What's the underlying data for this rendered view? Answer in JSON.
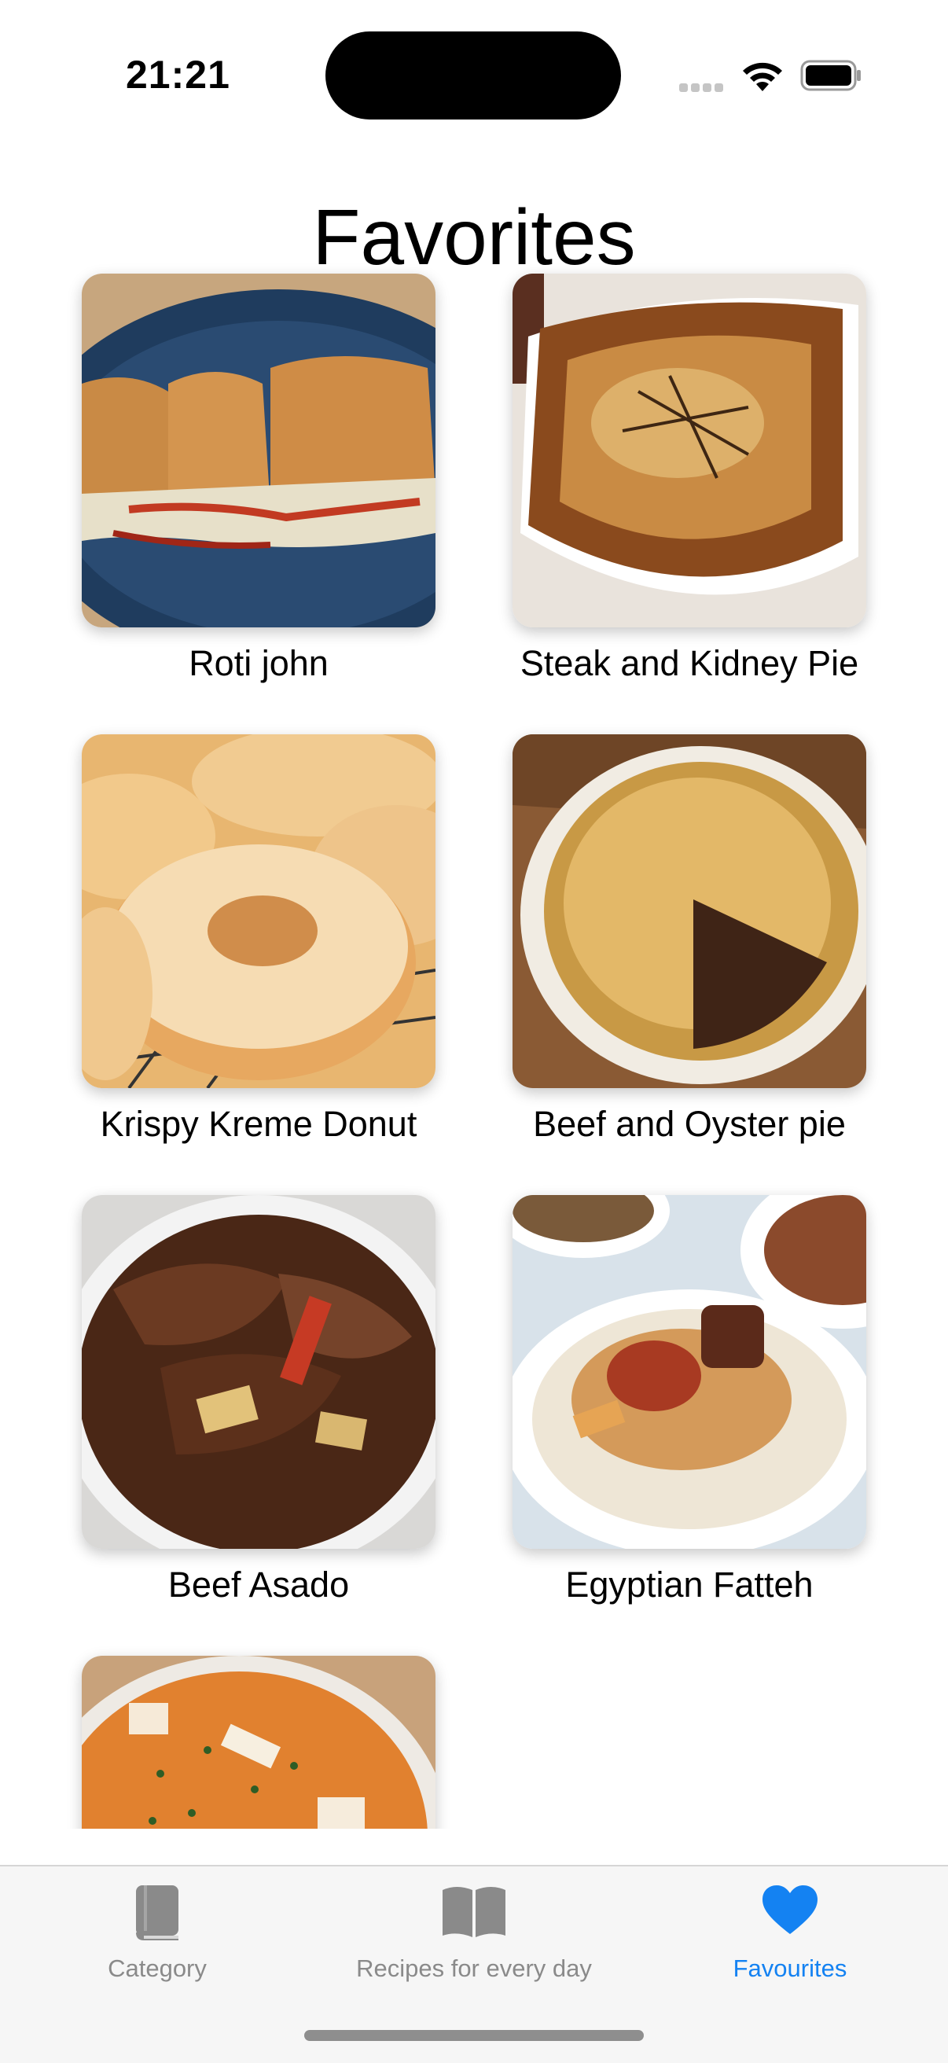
{
  "status": {
    "time": "21:21"
  },
  "title": "Favorites",
  "recipes": [
    {
      "name": "Roti john"
    },
    {
      "name": "Steak and Kidney Pie"
    },
    {
      "name": "Krispy Kreme Donut"
    },
    {
      "name": "Beef and Oyster pie"
    },
    {
      "name": "Beef Asado"
    },
    {
      "name": "Egyptian Fatteh"
    },
    {
      "name": ""
    }
  ],
  "tabs": [
    {
      "label": "Category",
      "icon": "book-icon"
    },
    {
      "label": "Recipes for every day",
      "icon": "open-book-icon"
    },
    {
      "label": "Favourites",
      "icon": "heart-icon"
    }
  ],
  "colors": {
    "accent": "#1482f2",
    "inactive": "#8a8a8a",
    "tab_bar_bg": "#f6f6f6"
  }
}
